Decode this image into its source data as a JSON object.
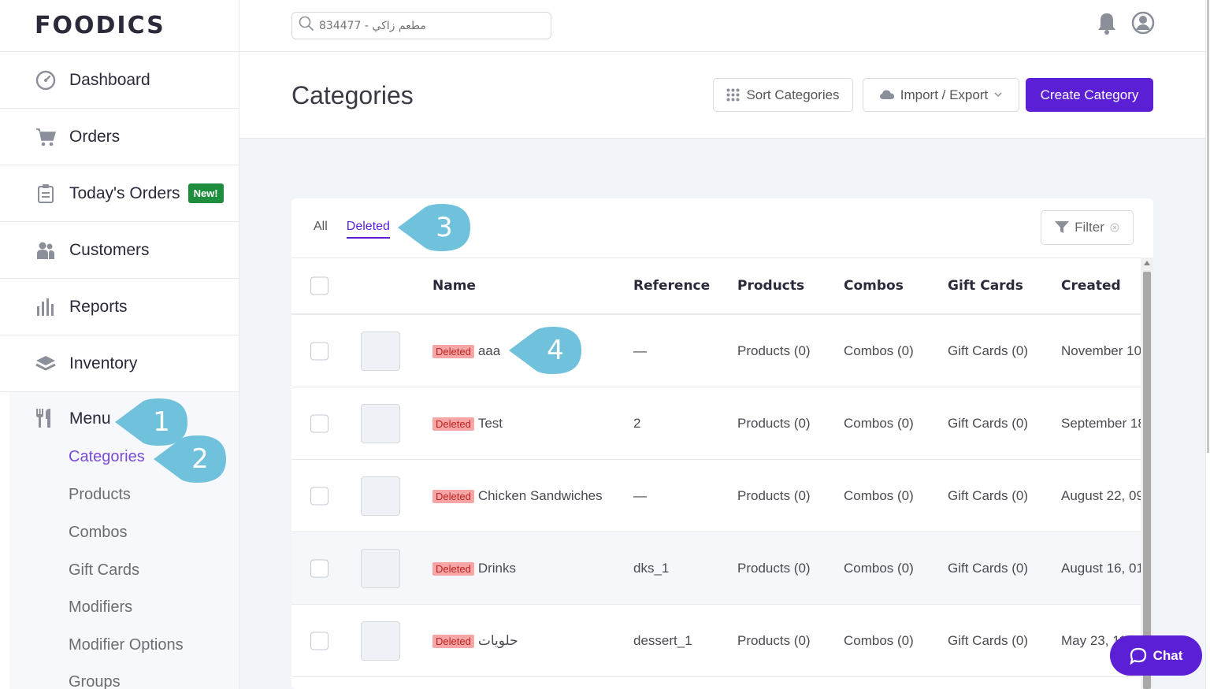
{
  "brand": {
    "logo": "FOODICS"
  },
  "sidebar": {
    "items": [
      {
        "label": "Dashboard",
        "icon": "dashboard-icon"
      },
      {
        "label": "Orders",
        "icon": "cart-icon"
      },
      {
        "label": "Today's Orders",
        "icon": "clipboard-icon",
        "badge": "New!"
      },
      {
        "label": "Customers",
        "icon": "customers-icon"
      },
      {
        "label": "Reports",
        "icon": "bar-chart-icon"
      },
      {
        "label": "Inventory",
        "icon": "layers-icon"
      }
    ],
    "menu": {
      "label": "Menu",
      "icon": "fork-knife-icon",
      "subitems": [
        "Categories",
        "Products",
        "Combos",
        "Gift Cards",
        "Modifiers",
        "Modifier Options",
        "Groups"
      ],
      "active": "Categories"
    }
  },
  "topbar": {
    "search_placeholder": "مطعم زاكي - 834477"
  },
  "header": {
    "title": "Categories",
    "sort_label": "Sort Categories",
    "import_label": "Import / Export",
    "create_label": "Create Category"
  },
  "tabs": {
    "all": "All",
    "deleted": "Deleted",
    "active": "Deleted"
  },
  "filter_label": "Filter",
  "table": {
    "columns": {
      "name": "Name",
      "reference": "Reference",
      "products": "Products",
      "combos": "Combos",
      "gift_cards": "Gift Cards",
      "created": "Created"
    },
    "deleted_badge": "Deleted",
    "rows": [
      {
        "name": "aaa",
        "reference": "—",
        "products": "Products (0)",
        "combos": "Combos (0)",
        "gift_cards": "Gift Cards (0)",
        "created": "November 10"
      },
      {
        "name": "Test",
        "reference": "2",
        "products": "Products (0)",
        "combos": "Combos (0)",
        "gift_cards": "Gift Cards (0)",
        "created": "September 18"
      },
      {
        "name": "Chicken Sandwiches",
        "reference": "—",
        "products": "Products (0)",
        "combos": "Combos (0)",
        "gift_cards": "Gift Cards (0)",
        "created": "August 22, 09"
      },
      {
        "name": "Drinks",
        "reference": "dks_1",
        "products": "Products (0)",
        "combos": "Combos (0)",
        "gift_cards": "Gift Cards (0)",
        "created": "August 16, 01:"
      },
      {
        "name": "حلويات",
        "reference": "dessert_1",
        "products": "Products (0)",
        "combos": "Combos (0)",
        "gift_cards": "Gift Cards (0)",
        "created": "May 23, 11"
      }
    ]
  },
  "callouts": [
    "1",
    "2",
    "3",
    "4"
  ],
  "chat_label": "Chat",
  "colors": {
    "accent": "#5b1fd6",
    "callout": "#6fc1dc",
    "new_badge": "#1e8e3e",
    "deleted_badge": "#f8a5a5"
  }
}
